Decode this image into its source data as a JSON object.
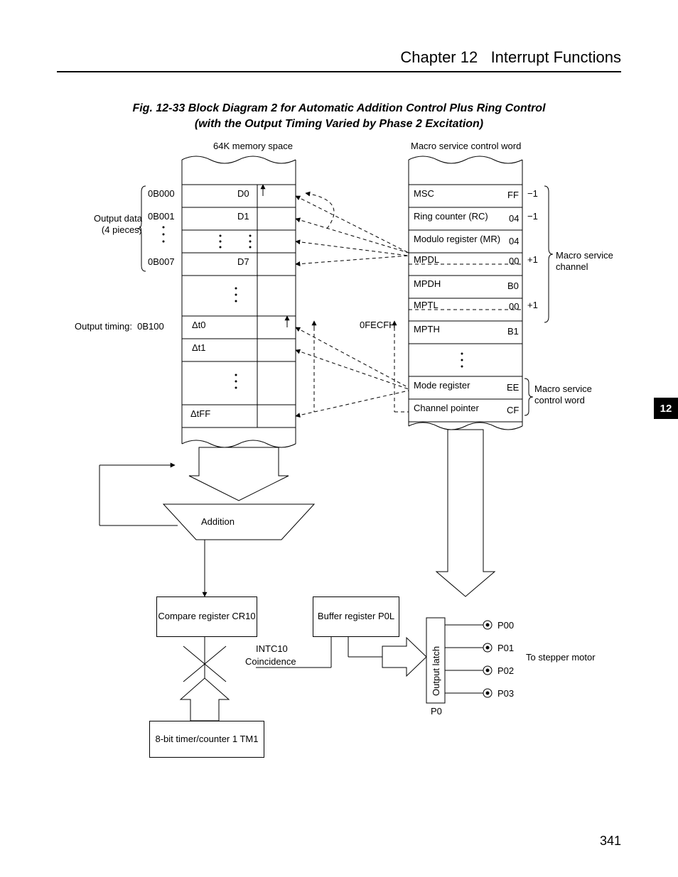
{
  "header": {
    "chapter": "Chapter 12",
    "title": "Interrupt Functions"
  },
  "caption": {
    "l1": "Fig. 12-33   Block Diagram 2 for Automatic Addition Control Plus Ring Control",
    "l2": "(with the Output Timing Varied by Phase 2 Excitation)"
  },
  "pageNumber": "341",
  "sideTab": "12",
  "head": {
    "left": "64K memory space",
    "right": "Macro service control word"
  },
  "leftGroup": {
    "label": "Output data\n(4 pieces)",
    "timingLabel": "Output timing:  0B100"
  },
  "addrs": {
    "a0": "0B000",
    "a1": "0B001",
    "a7": "0B007"
  },
  "cells": {
    "d0": "D0",
    "d1": "D1",
    "d7": "D7",
    "dt0": "Δt0",
    "dt1": "Δt1",
    "dtff": "ΔtFF"
  },
  "midLabel": "0FECFH",
  "msw": {
    "r0": {
      "l": "MSC",
      "r": "FF",
      "d": "−1"
    },
    "r1": {
      "l": "Ring counter (RC)",
      "r": "04",
      "d": "−1"
    },
    "r2": {
      "l": "Modulo register (MR)",
      "r": "04"
    },
    "r3": {
      "l": "MPDL",
      "r": "00",
      "d": "+1"
    },
    "r4": {
      "l": "MPDH",
      "r": "B0"
    },
    "r5": {
      "l": "MPTL",
      "r": "00",
      "d": "+1"
    },
    "r6": {
      "l": "MPTH",
      "r": "B1"
    },
    "rMode": {
      "l": "Mode register",
      "r": "EE"
    },
    "rChan": {
      "l": "Channel pointer",
      "r": "CF"
    }
  },
  "mswBraces": {
    "top": "Macro service\nchannel",
    "bot": "Macro service\ncontrol word"
  },
  "trapezoid": "Addition",
  "cr10": "Compare register\nCR10",
  "p0l": "Buffer register\nP0L",
  "intc10": {
    "a": "INTC10",
    "b": "Coincidence"
  },
  "tm1": "8-bit timer/counter 1\nTM1",
  "latch": "Output latch",
  "p0": "P0",
  "ports": {
    "p00": "P00",
    "p01": "P01",
    "p02": "P02",
    "p03": "P03"
  },
  "stepper": "To stepper motor"
}
